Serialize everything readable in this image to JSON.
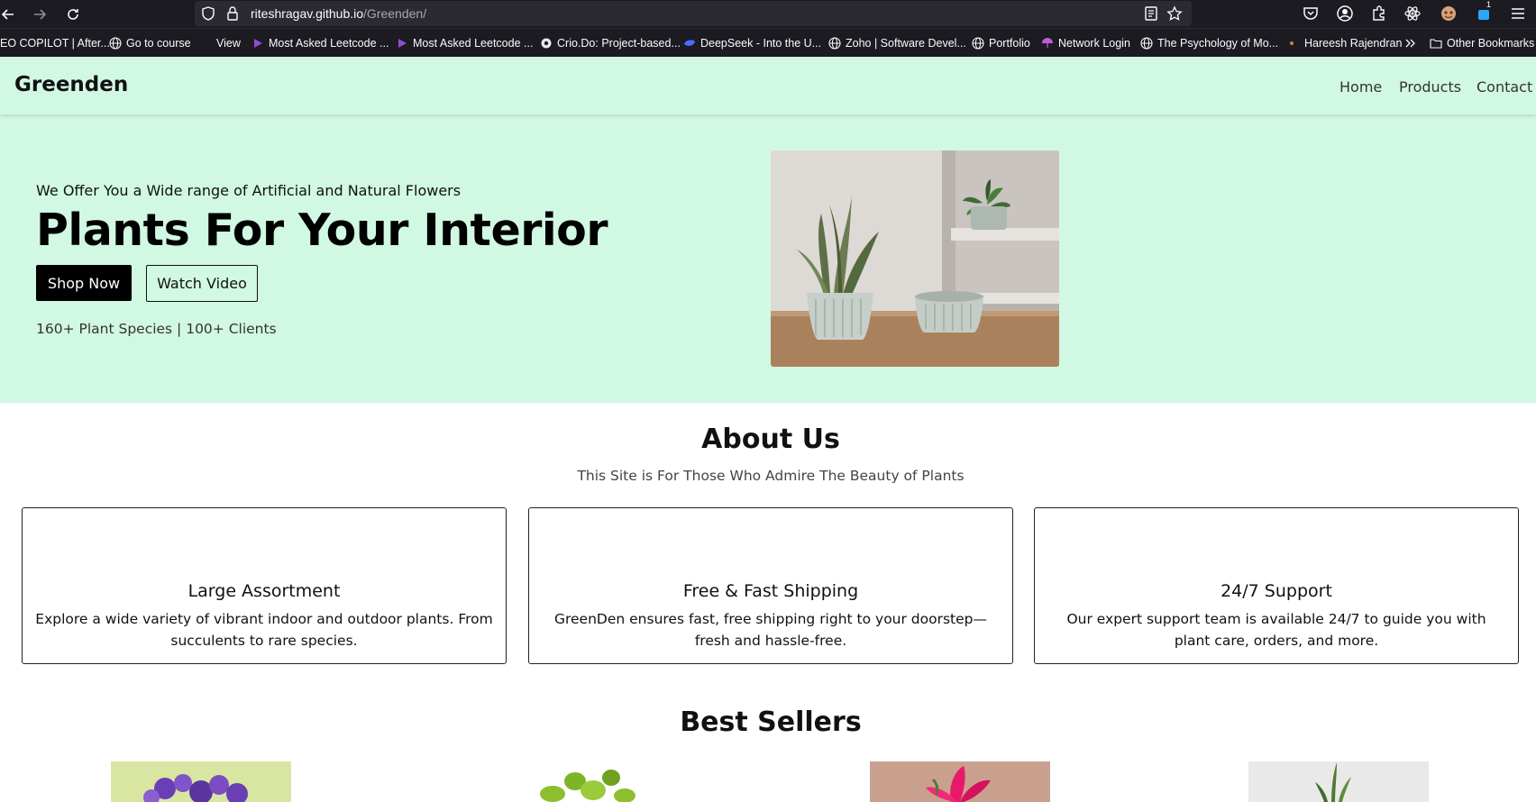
{
  "browser": {
    "url_host": "riteshragav.github.io",
    "url_path": "/Greenden/",
    "bookmarks": [
      {
        "label": "EO COPILOT | After...",
        "icon": "none"
      },
      {
        "label": "Go to course",
        "icon": "globe-icon"
      },
      {
        "label": "View",
        "icon": "none"
      },
      {
        "label": "Most Asked Leetcode ...",
        "icon": "play-icon"
      },
      {
        "label": "Most Asked Leetcode ...",
        "icon": "play-icon"
      },
      {
        "label": "Crio.Do: Project-based...",
        "icon": "crio-icon"
      },
      {
        "label": "DeepSeek - Into the U...",
        "icon": "deepseek-icon"
      },
      {
        "label": "Zoho | Software Devel...",
        "icon": "globe-icon"
      },
      {
        "label": "Portfolio",
        "icon": "globe-icon"
      },
      {
        "label": "Network Login",
        "icon": "umbrella-icon"
      },
      {
        "label": "The Psychology of Mo...",
        "icon": "globe-icon"
      },
      {
        "label": "Hareesh Rajendran",
        "icon": "dot-icon"
      },
      {
        "label": "Other Bookmarks",
        "icon": "folder-icon"
      }
    ],
    "extension_badge": "1"
  },
  "site": {
    "brand": "Greenden",
    "nav": {
      "home": "Home",
      "products": "Products",
      "contact": "Contact"
    }
  },
  "hero": {
    "subtitle": "We Offer You a Wide range of Artificial and Natural Flowers",
    "title": "Plants For Your Interior",
    "shop_label": "Shop Now",
    "video_label": "Watch Video",
    "stats": "160+ Plant Species | 100+ Clients"
  },
  "about": {
    "title": "About Us",
    "subtitle": "This Site is For Those Who Admire The Beauty of Plants",
    "cards": [
      {
        "title": "Large Assortment",
        "text": "Explore a wide variety of vibrant indoor and outdoor plants. From succulents to rare species."
      },
      {
        "title": "Free & Fast Shipping",
        "text": "GreenDen ensures fast, free shipping right to your doorstep—fresh and hassle-free."
      },
      {
        "title": "24/7 Support",
        "text": "Our expert support team is available 24/7 to guide you with plant care, orders, and more."
      }
    ]
  },
  "best_sellers": {
    "title": "Best Sellers"
  },
  "colors": {
    "mint": "#d1f8e3",
    "chrome": "#1c1b22",
    "button_dark": "#000000"
  }
}
